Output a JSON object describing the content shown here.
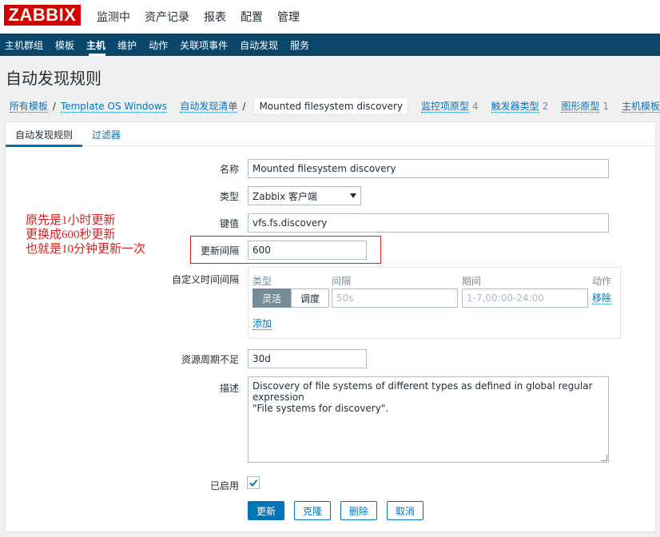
{
  "logo": "ZABBIX",
  "main_menu": [
    "监测中",
    "资产记录",
    "报表",
    "配置",
    "管理"
  ],
  "sub_menu": [
    {
      "label": "主机群组",
      "active": false
    },
    {
      "label": "模板",
      "active": false
    },
    {
      "label": "主机",
      "active": true
    },
    {
      "label": "维护",
      "active": false
    },
    {
      "label": "动作",
      "active": false
    },
    {
      "label": "关联项事件",
      "active": false
    },
    {
      "label": "自动发现",
      "active": false
    },
    {
      "label": "服务",
      "active": false
    }
  ],
  "page_title": "自动发现规则",
  "breadcrumb": {
    "all_templates": "所有模板",
    "template": "Template OS Windows",
    "discovery_list": "自动发现清单",
    "current": "Mounted filesystem discovery",
    "item_prototypes": {
      "label": "监控项原型",
      "count": "4"
    },
    "trigger_prototypes": {
      "label": "触发器类型",
      "count": "2"
    },
    "graph_prototypes": {
      "label": "图形原型",
      "count": "1"
    },
    "host_prototypes": {
      "label": "主机模板"
    }
  },
  "tabs": {
    "rule": "自动发现规则",
    "filters": "过滤器"
  },
  "form": {
    "name": {
      "label": "名称",
      "value": "Mounted filesystem discovery"
    },
    "type": {
      "label": "类型",
      "value": "Zabbix 客户端"
    },
    "key": {
      "label": "键值",
      "value": "vfs.fs.discovery"
    },
    "interval": {
      "label": "更新间隔",
      "value": "600"
    },
    "custom_intervals": {
      "label": "自定义时间间隔",
      "col_type": "类型",
      "col_interval": "间隔",
      "col_period": "期间",
      "col_action": "动作",
      "btn_flexible": "灵活",
      "btn_scheduling": "调度",
      "interval_placeholder": "50s",
      "period_placeholder": "1-7,00:00-24:00",
      "remove": "移除",
      "add": "添加"
    },
    "lifetime": {
      "label": "资源周期不足",
      "value": "30d"
    },
    "description": {
      "label": "描述",
      "line1": "Discovery of file systems of different types as defined in global regular expression",
      "line2": "\"File systems for discovery\"."
    },
    "enabled": {
      "label": "已启用",
      "checked": true
    }
  },
  "annotation": {
    "line1": "原先是1小时更新",
    "line2": "更换成600秒更新",
    "line3": "也就是10分钟更新一次",
    "color": "#d42020"
  },
  "buttons": {
    "update": "更新",
    "clone": "克隆",
    "delete": "删除",
    "cancel": "取消"
  },
  "colors": {
    "header": "#0a466a",
    "link": "#0275b8",
    "logo": "#d40000"
  }
}
